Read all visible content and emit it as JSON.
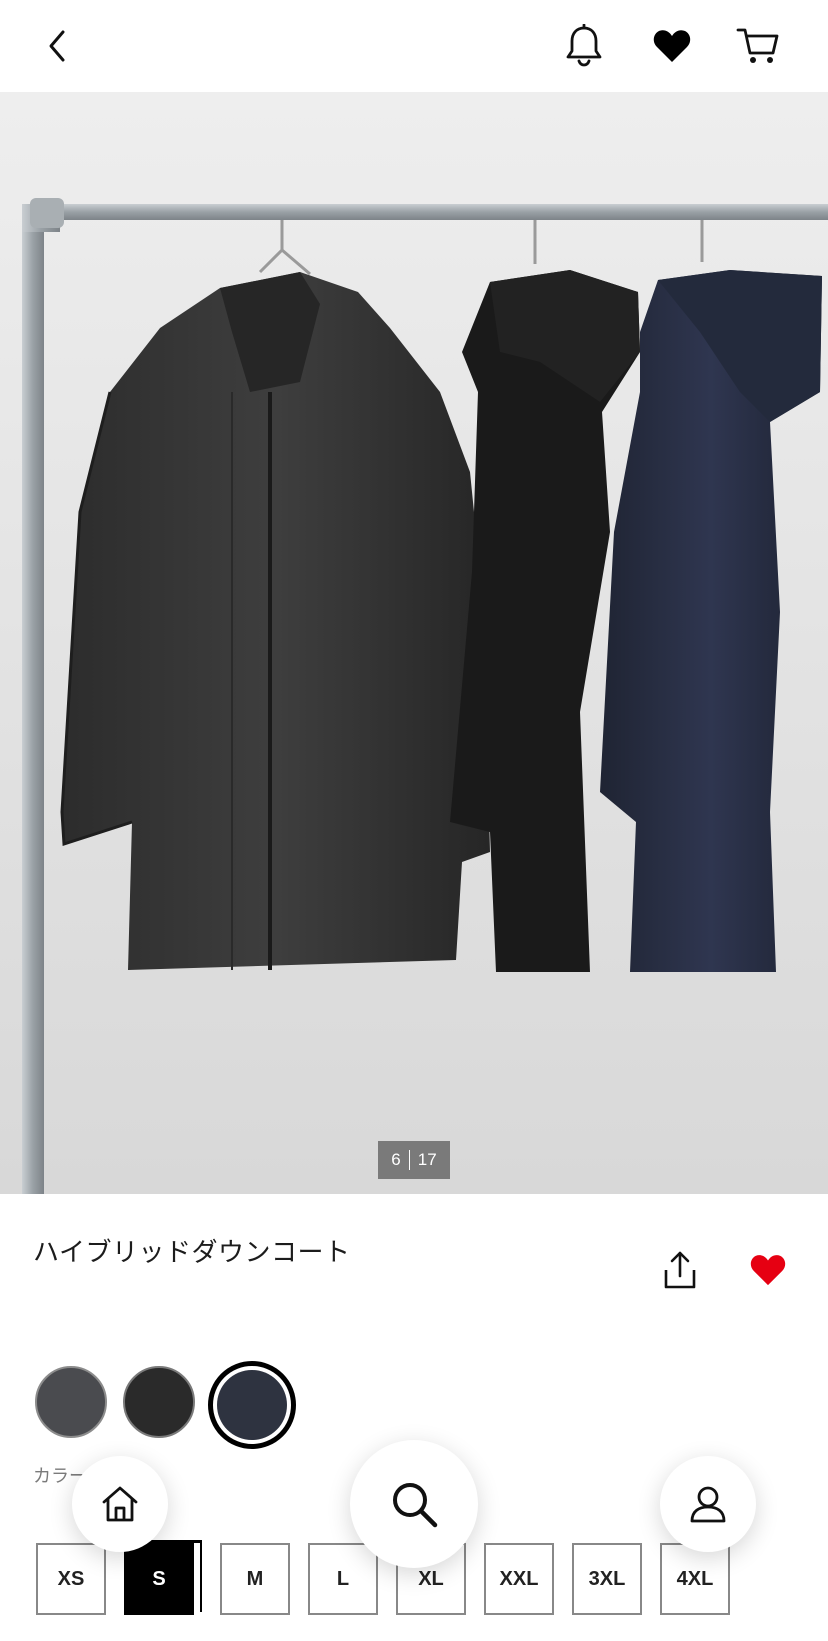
{
  "topbar": {
    "back_icon": "chevron-left-icon",
    "notifications_icon": "bell-icon",
    "favorites_icon": "heart-filled-icon",
    "cart_icon": "cart-icon"
  },
  "gallery": {
    "current": "6",
    "total": "17",
    "image": "three hooded coats on a clothing rail"
  },
  "product": {
    "title": "ハイブリッドダウンコート",
    "share_icon": "share-icon",
    "favorite_icon": "heart-filled-icon",
    "favorite_color": "#e60012"
  },
  "colors": {
    "label": "カラー：NAVY",
    "swatches": [
      {
        "hex": "#4a4b4f"
      },
      {
        "hex": "#2a2a2a"
      },
      {
        "hex": "#2e3340",
        "selected": true
      }
    ]
  },
  "sizes": {
    "options": [
      "XS",
      "S",
      "M",
      "L",
      "XL",
      "XXL",
      "3XL",
      "4XL"
    ],
    "selected": "S"
  },
  "bottom_nav": {
    "home_icon": "home-icon",
    "search_icon": "search-icon",
    "account_icon": "user-icon"
  }
}
